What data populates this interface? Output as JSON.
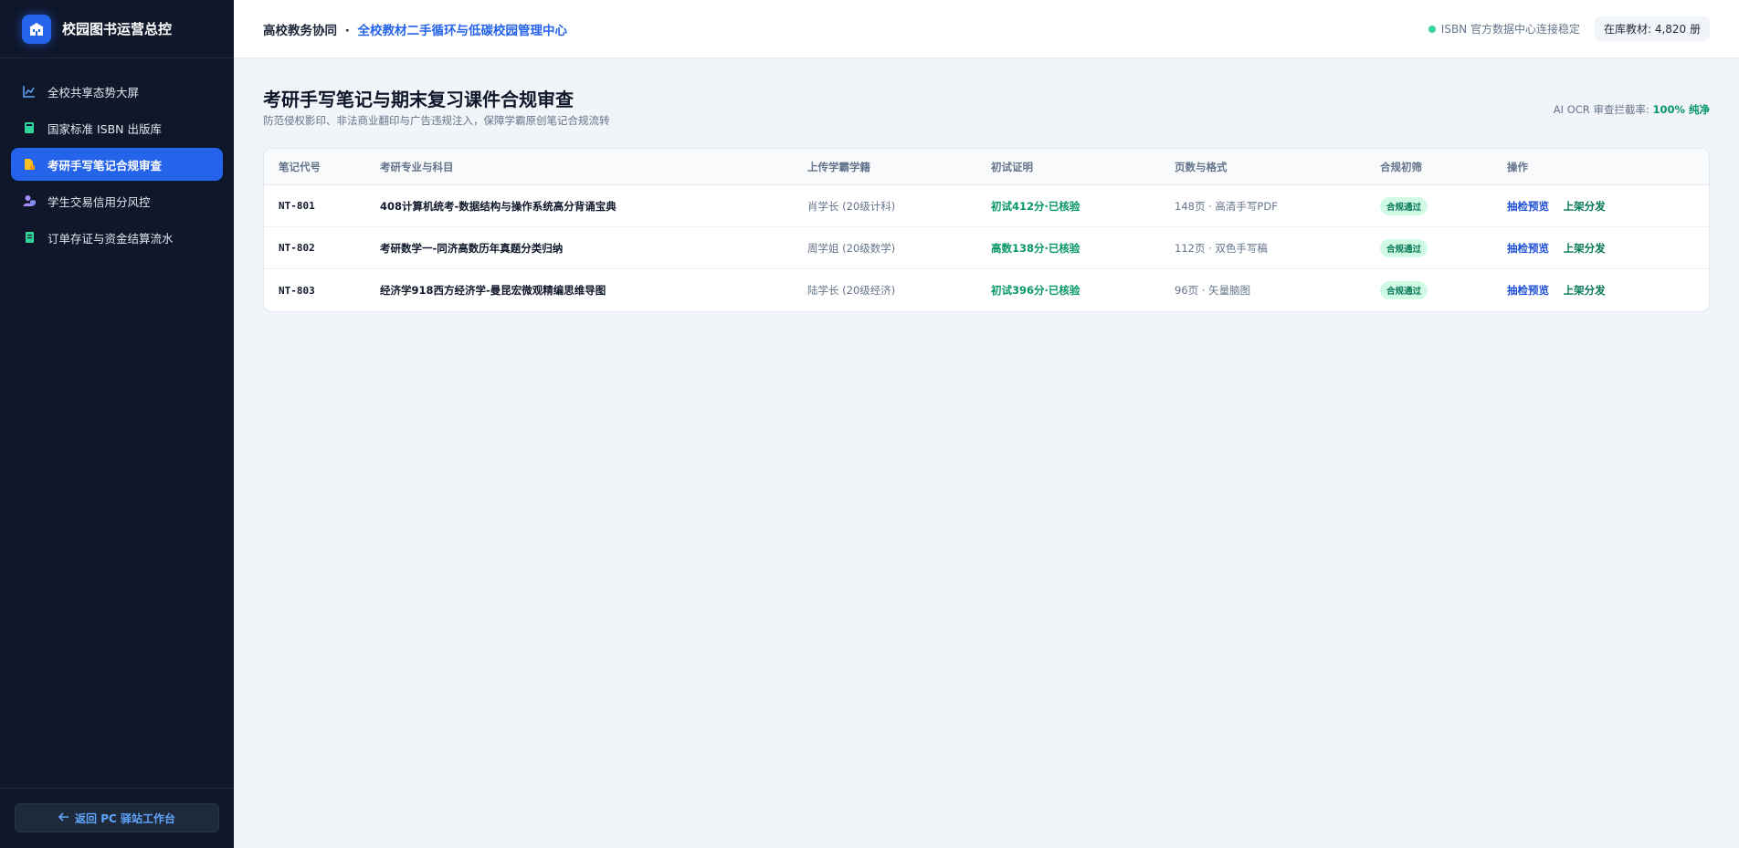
{
  "sidebar": {
    "brand": "校园图书运营总控",
    "items": [
      {
        "label": "全校共享态势大屏",
        "icon": "chart-line-icon",
        "active": false
      },
      {
        "label": "国家标准 ISBN 出版库",
        "icon": "book-icon",
        "active": false
      },
      {
        "label": "考研手写笔记合规审查",
        "icon": "file-edit-icon",
        "active": true
      },
      {
        "label": "学生交易信用分风控",
        "icon": "user-shield-icon",
        "active": false
      },
      {
        "label": "订单存证与资金结算流水",
        "icon": "receipt-icon",
        "active": false
      }
    ],
    "back_label": "返回 PC 驿站工作台"
  },
  "header": {
    "crumb_prefix": "高校教务协同",
    "crumb_sep": "·",
    "crumb_highlight": "全校教材二手循环与低碳校园管理中心",
    "status": "ISBN 官方数据中心连接稳定",
    "stock": "在库教材: 4,820 册"
  },
  "page": {
    "title": "考研手写笔记与期末复习课件合规审查",
    "subtitle": "防范侵权影印、非法商业翻印与广告违规注入，保障学霸原创笔记合规流转",
    "ocr_label": "AI OCR 审查拦截率:",
    "ocr_value": "100% 纯净"
  },
  "table": {
    "headers": [
      "笔记代号",
      "考研专业与科目",
      "上传学霸学籍",
      "初试证明",
      "页数与格式",
      "合规初筛",
      "操作"
    ],
    "rows": [
      {
        "code": "NT-801",
        "subject": "408计算机统考-数据结构与操作系统高分背诵宝典",
        "uploader": "肖学长 (20级计科)",
        "proof": "初试412分·已核验",
        "pages": "148页 · 高清手写PDF",
        "status": "合规通过",
        "action1": "抽检预览",
        "action2": "上架分发"
      },
      {
        "code": "NT-802",
        "subject": "考研数学一-同济高数历年真题分类归纳",
        "uploader": "周学姐 (20级数学)",
        "proof": "高数138分·已核验",
        "pages": "112页 · 双色手写稿",
        "status": "合规通过",
        "action1": "抽检预览",
        "action2": "上架分发"
      },
      {
        "code": "NT-803",
        "subject": "经济学918西方经济学-曼昆宏微观精编思维导图",
        "uploader": "陆学长 (20级经济)",
        "proof": "初试396分·已核验",
        "pages": "96页 · 矢量脑图",
        "status": "合规通过",
        "action1": "抽检预览",
        "action2": "上架分发"
      }
    ]
  }
}
